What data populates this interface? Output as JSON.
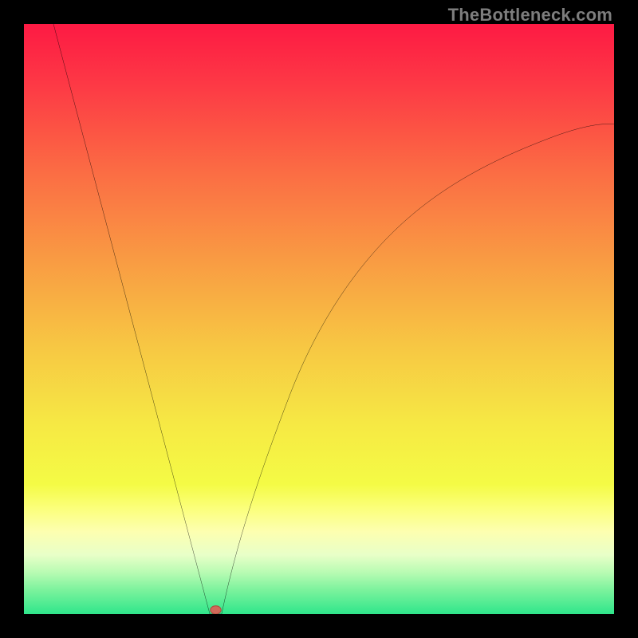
{
  "watermark": "TheBottleneck.com",
  "chart_data": {
    "type": "line",
    "title": "",
    "xlabel": "",
    "ylabel": "",
    "xlim": [
      0,
      100
    ],
    "ylim": [
      0,
      100
    ],
    "grid": false,
    "legend": false,
    "series": [
      {
        "name": "left-branch",
        "x": [
          5,
          10,
          15,
          20,
          25,
          28,
          30,
          31,
          31.5
        ],
        "values": [
          100,
          82,
          63,
          44,
          25,
          13,
          6,
          2,
          0
        ]
      },
      {
        "name": "right-branch",
        "x": [
          33.5,
          35,
          38,
          42,
          48,
          55,
          63,
          72,
          82,
          92,
          100
        ],
        "values": [
          0,
          5,
          15,
          28,
          42,
          54,
          63,
          70,
          76,
          80,
          83
        ]
      }
    ],
    "annotations": [
      {
        "name": "bottleneck-point",
        "x": 32.5,
        "y": 0,
        "color": "#d16a5a"
      }
    ],
    "background": {
      "type": "vertical-gradient",
      "stops": [
        {
          "pos": 0.0,
          "color": "#fd1a44"
        },
        {
          "pos": 0.1,
          "color": "#fd3845"
        },
        {
          "pos": 0.25,
          "color": "#fb6c44"
        },
        {
          "pos": 0.4,
          "color": "#f99b43"
        },
        {
          "pos": 0.55,
          "color": "#f7c843"
        },
        {
          "pos": 0.68,
          "color": "#f6e944"
        },
        {
          "pos": 0.78,
          "color": "#f4fb45"
        },
        {
          "pos": 0.82,
          "color": "#fbff7a"
        },
        {
          "pos": 0.86,
          "color": "#fdffb0"
        },
        {
          "pos": 0.9,
          "color": "#e8ffc8"
        },
        {
          "pos": 0.93,
          "color": "#b7fbb2"
        },
        {
          "pos": 0.96,
          "color": "#7af29c"
        },
        {
          "pos": 1.0,
          "color": "#2fe68b"
        }
      ]
    }
  }
}
